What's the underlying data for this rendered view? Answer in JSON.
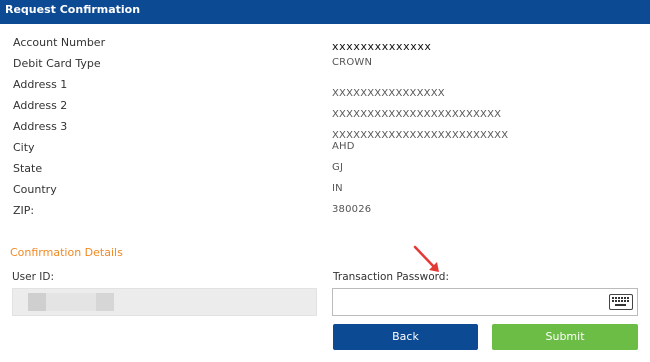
{
  "header": {
    "title": "Request Confirmation"
  },
  "details": [
    {
      "label": "Account Number",
      "value": "xxxxxxxxxxxxxx"
    },
    {
      "label": "Debit Card Type",
      "value": "CROWN"
    },
    {
      "label": "Address 1",
      "value": "XXXXXXXXXXXXXXXX"
    },
    {
      "label": "Address 2",
      "value": "XXXXXXXXXXXXXXXXXXXXXXXX"
    },
    {
      "label": "Address 3",
      "value": "XXXXXXXXXXXXXXXXXXXXXXXXX"
    },
    {
      "label": "City",
      "value": "AHD"
    },
    {
      "label": "State",
      "value": "GJ"
    },
    {
      "label": "Country",
      "value": "IN"
    },
    {
      "label": "ZIP:",
      "value": "380026"
    }
  ],
  "confirmation": {
    "section_title": "Confirmation Details",
    "user_id_label": "User ID:",
    "password_label": "Transaction Password:",
    "password_value": "",
    "keyboard_icon": "virtual-keyboard-icon"
  },
  "buttons": {
    "back": "Back",
    "submit": "Submit"
  },
  "colors": {
    "header": "#0d4a94",
    "accent_orange": "#f08a24",
    "back": "#0d4a94",
    "submit": "#6cbd45",
    "arrow": "#e53935"
  }
}
